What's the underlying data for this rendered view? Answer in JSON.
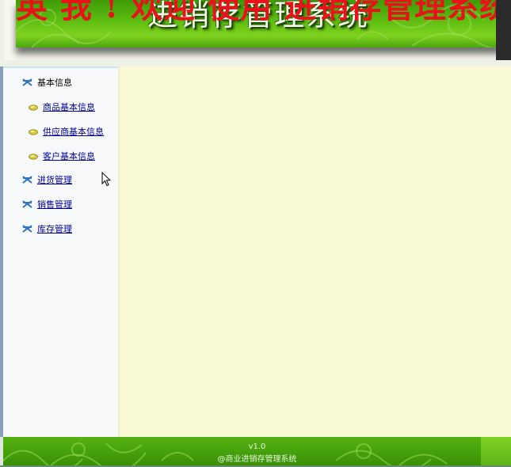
{
  "header": {
    "title": "进销存管理系统",
    "scrolling_text": "英 我 ! 欢迎 使用 进销存管理系统"
  },
  "sidebar": {
    "items": [
      {
        "label": "基本信息",
        "link": false
      },
      {
        "label": "商品基本信息",
        "link": true
      },
      {
        "label": "供应商基本信息",
        "link": true
      },
      {
        "label": "客户基本信息",
        "link": true
      },
      {
        "label": "进货管理",
        "link": true
      },
      {
        "label": "销售管理",
        "link": true
      },
      {
        "label": "库存管理",
        "link": true
      }
    ]
  },
  "footer": {
    "version": "v1.0",
    "copyright": "@商业进销存管理系统"
  },
  "icons": {
    "section_icon": "blue-ribbon-icon",
    "sub_icon": "yellow-bullet-icon"
  },
  "colors": {
    "link": "#00009c",
    "content_bg": "#f8f8d4",
    "banner_green": "#5fbe12",
    "marquee_red": "#e8121a"
  }
}
